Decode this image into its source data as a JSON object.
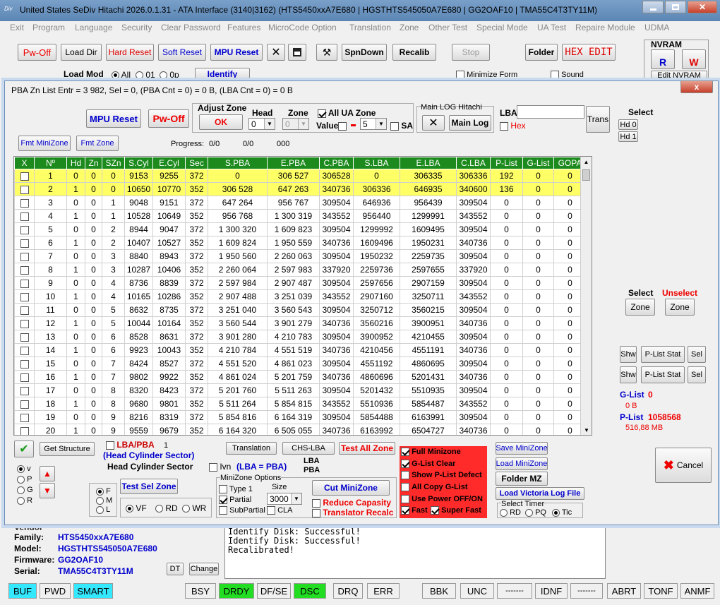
{
  "window": {
    "title": "United States  SeDiv Hitachi  2026.0.1.31 - ATA Interface  (3140|3162) (HTS5450xxA7E680  | HGSTHTS545050A7E680  | GG2OAF10  | TMA55C4T3TY11M)",
    "app_icon": "Div"
  },
  "menu": [
    "Exit",
    "Program",
    "Language",
    "Security",
    "Clear Password",
    "Features",
    "MicroCode Option",
    "Translation",
    "Zone",
    "Other Test",
    "Special Mode",
    "UA Test",
    "Repaire Module",
    "UDMA"
  ],
  "toolbar": {
    "pwoff": "Pw-Off",
    "loaddir": "Load Dir",
    "hardreset": "Hard Reset",
    "softreset": "Soft Reset",
    "mpureset": "MPU Reset",
    "spndown": "SpnDown",
    "recalib": "Recalib",
    "stop": "Stop",
    "folder": "Folder",
    "hexedit": "HEX EDIT",
    "loadmod": "Load Mod",
    "all": "All",
    "o1": "01",
    "op": "0p",
    "identify": "Identify",
    "minimize": "Minimize Form",
    "sound": "Sound",
    "nvram": "NVRAM",
    "nvram_r": "R",
    "nvram_w": "W",
    "editnvram": "Edit NVRAM"
  },
  "dialog": {
    "title": "PBA Zn List Entr = 3 982, Sel = 0, (PBA Cnt = 0) = 0 B, (LBA Cnt = 0) = 0 B",
    "close": "x"
  },
  "top": {
    "mpu_reset": "MPU Reset",
    "pw_off": "Pw-Off",
    "adjust_zone": "Adjust Zone",
    "ok": "OK",
    "head": "Head",
    "zone": "Zone",
    "head_val": "0",
    "zone_val": "0",
    "all_ua": "All UA Zone",
    "value": "Value",
    "value_num": "5",
    "sa": "SA",
    "mainlog_title": "Main LOG Hitachi",
    "main_log": "Main Log",
    "lba": "LBA",
    "hex": "Hex",
    "trans": "Trans",
    "fmt_minizone": "Fmt MiniZone",
    "fmt_zone": "Fmt Zone",
    "progress_label": "Progress:",
    "progress_a": "0/0",
    "progress_b": "0/0",
    "progress_c": "000"
  },
  "table": {
    "columns": [
      "X",
      "Nº",
      "Hd",
      "Zn",
      "SZn",
      "S.Cyl",
      "E.Cyl",
      "Sec",
      "S.PBA",
      "E.PBA",
      "C.PBA",
      "S.LBA",
      "E.LBA",
      "C.LBA",
      "P-List",
      "G-List",
      "GOPA"
    ],
    "rows": [
      [
        "1",
        "0",
        "0",
        "0",
        "9153",
        "9255",
        "372",
        "0",
        "306 527",
        "306528",
        "0",
        "306335",
        "306336",
        "192",
        "0",
        "0"
      ],
      [
        "2",
        "1",
        "0",
        "0",
        "10650",
        "10770",
        "352",
        "306 528",
        "647 263",
        "340736",
        "306336",
        "646935",
        "340600",
        "136",
        "0",
        "0"
      ],
      [
        "3",
        "0",
        "0",
        "1",
        "9048",
        "9151",
        "372",
        "647 264",
        "956 767",
        "309504",
        "646936",
        "956439",
        "309504",
        "0",
        "0",
        "0"
      ],
      [
        "4",
        "1",
        "0",
        "1",
        "10528",
        "10649",
        "352",
        "956 768",
        "1 300 319",
        "343552",
        "956440",
        "1299991",
        "343552",
        "0",
        "0",
        "0"
      ],
      [
        "5",
        "0",
        "0",
        "2",
        "8944",
        "9047",
        "372",
        "1 300 320",
        "1 609 823",
        "309504",
        "1299992",
        "1609495",
        "309504",
        "0",
        "0",
        "0"
      ],
      [
        "6",
        "1",
        "0",
        "2",
        "10407",
        "10527",
        "352",
        "1 609 824",
        "1 950 559",
        "340736",
        "1609496",
        "1950231",
        "340736",
        "0",
        "0",
        "0"
      ],
      [
        "7",
        "0",
        "0",
        "3",
        "8840",
        "8943",
        "372",
        "1 950 560",
        "2 260 063",
        "309504",
        "1950232",
        "2259735",
        "309504",
        "0",
        "0",
        "0"
      ],
      [
        "8",
        "1",
        "0",
        "3",
        "10287",
        "10406",
        "352",
        "2 260 064",
        "2 597 983",
        "337920",
        "2259736",
        "2597655",
        "337920",
        "0",
        "0",
        "0"
      ],
      [
        "9",
        "0",
        "0",
        "4",
        "8736",
        "8839",
        "372",
        "2 597 984",
        "2 907 487",
        "309504",
        "2597656",
        "2907159",
        "309504",
        "0",
        "0",
        "0"
      ],
      [
        "10",
        "1",
        "0",
        "4",
        "10165",
        "10286",
        "352",
        "2 907 488",
        "3 251 039",
        "343552",
        "2907160",
        "3250711",
        "343552",
        "0",
        "0",
        "0"
      ],
      [
        "11",
        "0",
        "0",
        "5",
        "8632",
        "8735",
        "372",
        "3 251 040",
        "3 560 543",
        "309504",
        "3250712",
        "3560215",
        "309504",
        "0",
        "0",
        "0"
      ],
      [
        "12",
        "1",
        "0",
        "5",
        "10044",
        "10164",
        "352",
        "3 560 544",
        "3 901 279",
        "340736",
        "3560216",
        "3900951",
        "340736",
        "0",
        "0",
        "0"
      ],
      [
        "13",
        "0",
        "0",
        "6",
        "8528",
        "8631",
        "372",
        "3 901 280",
        "4 210 783",
        "309504",
        "3900952",
        "4210455",
        "309504",
        "0",
        "0",
        "0"
      ],
      [
        "14",
        "1",
        "0",
        "6",
        "9923",
        "10043",
        "352",
        "4 210 784",
        "4 551 519",
        "340736",
        "4210456",
        "4551191",
        "340736",
        "0",
        "0",
        "0"
      ],
      [
        "15",
        "0",
        "0",
        "7",
        "8424",
        "8527",
        "372",
        "4 551 520",
        "4 861 023",
        "309504",
        "4551192",
        "4860695",
        "309504",
        "0",
        "0",
        "0"
      ],
      [
        "16",
        "1",
        "0",
        "7",
        "9802",
        "9922",
        "352",
        "4 861 024",
        "5 201 759",
        "340736",
        "4860696",
        "5201431",
        "340736",
        "0",
        "0",
        "0"
      ],
      [
        "17",
        "0",
        "0",
        "8",
        "8320",
        "8423",
        "372",
        "5 201 760",
        "5 511 263",
        "309504",
        "5201432",
        "5510935",
        "309504",
        "0",
        "0",
        "0"
      ],
      [
        "18",
        "1",
        "0",
        "8",
        "9680",
        "9801",
        "352",
        "5 511 264",
        "5 854 815",
        "343552",
        "5510936",
        "5854487",
        "343552",
        "0",
        "0",
        "0"
      ],
      [
        "19",
        "0",
        "0",
        "9",
        "8216",
        "8319",
        "372",
        "5 854 816",
        "6 164 319",
        "309504",
        "5854488",
        "6163991",
        "309504",
        "0",
        "0",
        "0"
      ],
      [
        "20",
        "1",
        "0",
        "9",
        "9559",
        "9679",
        "352",
        "6 164 320",
        "6 505 055",
        "340736",
        "6163992",
        "6504727",
        "340736",
        "0",
        "0",
        "0"
      ]
    ]
  },
  "right": {
    "select": "Select",
    "hd0": "Hd 0",
    "hd1": "Hd 1",
    "select2": "Select",
    "unselect": "Unselect",
    "zone": "Zone",
    "zone2": "Zone",
    "shw1": "Shw",
    "plist_stat1": "P-List Stat",
    "sel1": "Sel",
    "shw2": "Shw",
    "plist_stat2": "P-List Stat",
    "sel2": "Sel",
    "glist_label": "G-List",
    "glist_val": "0",
    "glist_size": "0 B",
    "plist_label": "P-List",
    "plist_val": "1058568",
    "plist_size": "516,88 MB"
  },
  "bottom": {
    "get_structure": "Get Structure",
    "lba_pba": "LBA/PBA",
    "lba_pba_num": "1",
    "hcs": "(Head   Cylinder   Sector)",
    "hcs2": "Head   Cylinder   Sector",
    "ivn": "Ivn",
    "lba_eq_pba": "(LBA = PBA)",
    "translation": "Translation",
    "chs_lba": "CHS-LBA",
    "test_all_zone": "Test All Zone",
    "lba2": "LBA",
    "pba2": "PBA",
    "r_v": "v",
    "r_p": "P",
    "r_g": "G",
    "r_r": "R",
    "f": "F",
    "m": "M",
    "l": "L",
    "test_sel_zone": "Test Sel Zone",
    "vf": "VF",
    "rd": "RD",
    "wr": "WR",
    "minizone_options": "MiniZone Options",
    "size": "Size",
    "type1": "Type 1",
    "partial": "Partial",
    "size_val": "3000",
    "subpartial": "SubPartial",
    "cla": "CLA",
    "cut_minizone": "Cut MiniZone",
    "reduce_capacity": "Reduce Capasity",
    "translator_recalc": "Translator Recalc",
    "full_minizone": "Full Minizone",
    "glist_clear": "G-List Clear",
    "show_plist_defect": "Show P-List Defect",
    "all_copy_glist": "All Copy G-List",
    "use_power": "Use Power OFF/ON",
    "fast": "Fast",
    "super_fast": "Super Fast",
    "save_minizone": "Save MiniZone",
    "load_minizone": "Load MiniZone",
    "folder_mz": "Folder MZ",
    "load_victoria": "Load Victoria Log File",
    "select_timer": "Select Timer",
    "t_rd": "RD",
    "t_pq": "PQ",
    "t_tic": "Tic",
    "cancel": "Cancel"
  },
  "info": {
    "vendor_label": "Vendor",
    "family_label": "Family:",
    "family": "HTS5450xxA7E680",
    "model_label": "Model:",
    "model": "HGSTHTS545050A7E680",
    "firmware_label": "Firmware:",
    "firmware": "GG2OAF10",
    "serial_label": "Serial:",
    "serial": "TMA55C4T3TY11M",
    "dt": "DT",
    "change": "Change",
    "log": [
      "Identify Disk: Successful!",
      "Identify Disk: Successful!",
      "Recalibrated!"
    ]
  },
  "status": [
    "BUF",
    "PWD",
    "SMART",
    "BSY",
    "DRDY",
    "DF/SE",
    "DSC",
    "DRQ",
    "ERR",
    "BBK",
    "UNC",
    "-------",
    "IDNF",
    "-------",
    "ABRT",
    "TONF",
    "ANMF"
  ],
  "colors": {
    "green": "#22dd22",
    "cyan": "#33e8ff",
    "header_green": "#1c8a1c",
    "yellow": "#ffff66",
    "red": "#ff2a2a",
    "blue": "#0000cc"
  }
}
